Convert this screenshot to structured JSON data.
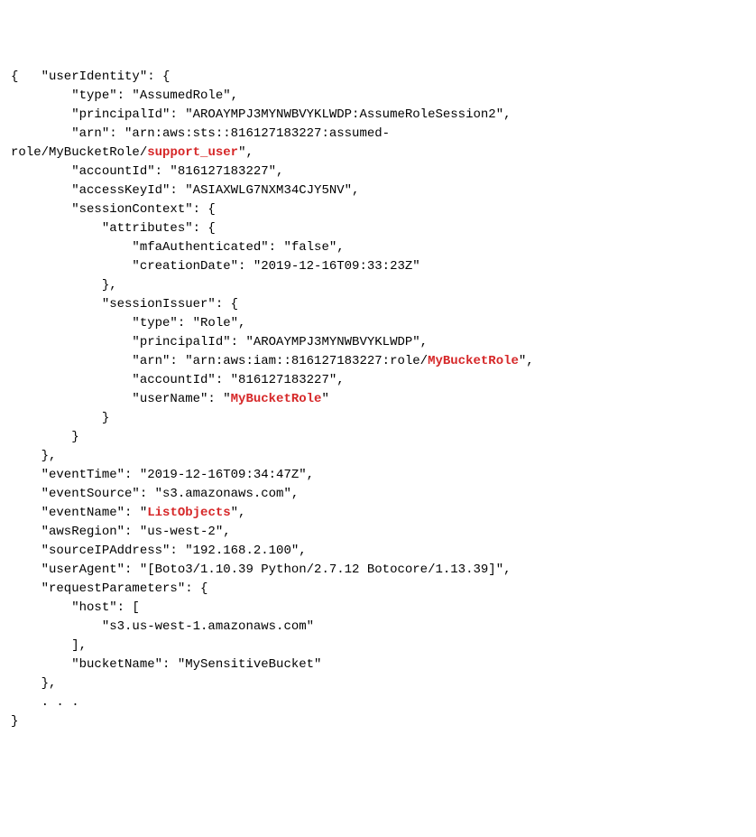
{
  "lines": [
    {
      "prefix": "{   \"userIdentity\": {",
      "hl": "",
      "suffix": ""
    },
    {
      "prefix": "        \"type\": \"AssumedRole\",",
      "hl": "",
      "suffix": ""
    },
    {
      "prefix": "        \"principalId\": \"AROAYMPJ3MYNWBVYKLWDP:AssumeRoleSession2\",",
      "hl": "",
      "suffix": ""
    },
    {
      "prefix": "        \"arn\": \"arn:aws:sts::816127183227:assumed-",
      "hl": "",
      "suffix": ""
    },
    {
      "prefix": "role/MyBucketRole/",
      "hl": "support_user",
      "suffix": "\","
    },
    {
      "prefix": "        \"accountId\": \"816127183227\",",
      "hl": "",
      "suffix": ""
    },
    {
      "prefix": "        \"accessKeyId\": \"ASIAXWLG7NXM34CJY5NV\",",
      "hl": "",
      "suffix": ""
    },
    {
      "prefix": "        \"sessionContext\": {",
      "hl": "",
      "suffix": ""
    },
    {
      "prefix": "            \"attributes\": {",
      "hl": "",
      "suffix": ""
    },
    {
      "prefix": "                \"mfaAuthenticated\": \"false\",",
      "hl": "",
      "suffix": ""
    },
    {
      "prefix": "                \"creationDate\": \"2019-12-16T09:33:23Z\"",
      "hl": "",
      "suffix": ""
    },
    {
      "prefix": "            },",
      "hl": "",
      "suffix": ""
    },
    {
      "prefix": "            \"sessionIssuer\": {",
      "hl": "",
      "suffix": ""
    },
    {
      "prefix": "                \"type\": \"Role\",",
      "hl": "",
      "suffix": ""
    },
    {
      "prefix": "                \"principalId\": \"AROAYMPJ3MYNWBVYKLWDP\",",
      "hl": "",
      "suffix": ""
    },
    {
      "prefix": "                \"arn\": \"arn:aws:iam::816127183227:role/",
      "hl": "MyBucketRole",
      "suffix": "\","
    },
    {
      "prefix": "                \"accountId\": \"816127183227\",",
      "hl": "",
      "suffix": ""
    },
    {
      "prefix": "                \"userName\": \"",
      "hl": "MyBucketRole",
      "suffix": "\""
    },
    {
      "prefix": "            }",
      "hl": "",
      "suffix": ""
    },
    {
      "prefix": "        }",
      "hl": "",
      "suffix": ""
    },
    {
      "prefix": "    },",
      "hl": "",
      "suffix": ""
    },
    {
      "prefix": "    \"eventTime\": \"2019-12-16T09:34:47Z\",",
      "hl": "",
      "suffix": ""
    },
    {
      "prefix": "    \"eventSource\": \"s3.amazonaws.com\",",
      "hl": "",
      "suffix": ""
    },
    {
      "prefix": "    \"eventName\": \"",
      "hl": "ListObjects",
      "suffix": "\","
    },
    {
      "prefix": "    \"awsRegion\": \"us-west-2\",",
      "hl": "",
      "suffix": ""
    },
    {
      "prefix": "    \"sourceIPAddress\": \"192.168.2.100\",",
      "hl": "",
      "suffix": ""
    },
    {
      "prefix": "    \"userAgent\": \"[Boto3/1.10.39 Python/2.7.12 Botocore/1.13.39]\",",
      "hl": "",
      "suffix": ""
    },
    {
      "prefix": "    \"requestParameters\": {",
      "hl": "",
      "suffix": ""
    },
    {
      "prefix": "        \"host\": [",
      "hl": "",
      "suffix": ""
    },
    {
      "prefix": "            \"s3.us-west-1.amazonaws.com\"",
      "hl": "",
      "suffix": ""
    },
    {
      "prefix": "        ],",
      "hl": "",
      "suffix": ""
    },
    {
      "prefix": "        \"bucketName\": \"MySensitiveBucket\"",
      "hl": "",
      "suffix": ""
    },
    {
      "prefix": "    },",
      "hl": "",
      "suffix": ""
    },
    {
      "prefix": "    . . .",
      "hl": "",
      "suffix": ""
    },
    {
      "prefix": "}",
      "hl": "",
      "suffix": ""
    }
  ]
}
